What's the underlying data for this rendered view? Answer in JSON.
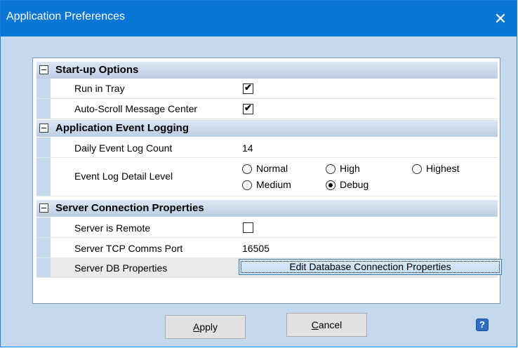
{
  "window": {
    "title": "Application Preferences",
    "close_glyph": "✕"
  },
  "sections": [
    {
      "title": "Start-up Options",
      "rows": [
        {
          "label": "Run in Tray",
          "checked": true
        },
        {
          "label": "Auto-Scroll Message Center",
          "checked": true
        }
      ]
    },
    {
      "title": "Application Event Logging",
      "rows": [
        {
          "label": "Daily Event Log Count",
          "value": "14"
        },
        {
          "label": "Event Log Detail Level",
          "options": [
            "Normal",
            "High",
            "Highest",
            "Medium",
            "Debug"
          ],
          "selected": "Debug"
        }
      ]
    },
    {
      "title": "Server Connection Properties",
      "rows": [
        {
          "label": "Server is Remote",
          "checked": false
        },
        {
          "label": "Server TCP Comms Port",
          "value": "16505"
        },
        {
          "label": "Server DB Properties",
          "button": "Edit Database Connection Properties"
        }
      ]
    }
  ],
  "footer": {
    "apply_mnemonic": "A",
    "apply_rest": "pply",
    "cancel_mnemonic": "C",
    "cancel_rest": "ancel",
    "help_glyph": "?"
  },
  "colors": {
    "titlebar": "#0a77d6",
    "window_bg": "#c4d8ee",
    "section_header": "#bccde3"
  },
  "icons": [
    "close-icon",
    "collapse-icon",
    "checkmark-icon",
    "help-icon"
  ]
}
